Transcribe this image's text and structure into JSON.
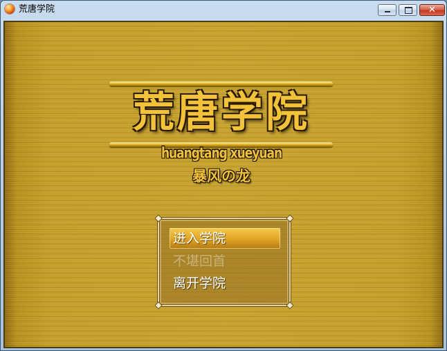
{
  "window": {
    "title": "荒唐学院",
    "controls": {
      "minimize": "minimize",
      "maximize": "maximize",
      "close": "✕"
    }
  },
  "logo": {
    "title": "荒唐学院",
    "pinyin": "huangtang xueyuan",
    "subtitle": "暴风の龙"
  },
  "menu": {
    "items": [
      {
        "label": "进入学院",
        "state": "selected"
      },
      {
        "label": "不堪回首",
        "state": "disabled"
      },
      {
        "label": "离开学院",
        "state": "normal"
      }
    ]
  },
  "colors": {
    "background_gold": "#c6a22f",
    "logo_gold": "#f2c23a",
    "selection_gold": "#e0a424",
    "disabled_text": "#c9b27a"
  }
}
